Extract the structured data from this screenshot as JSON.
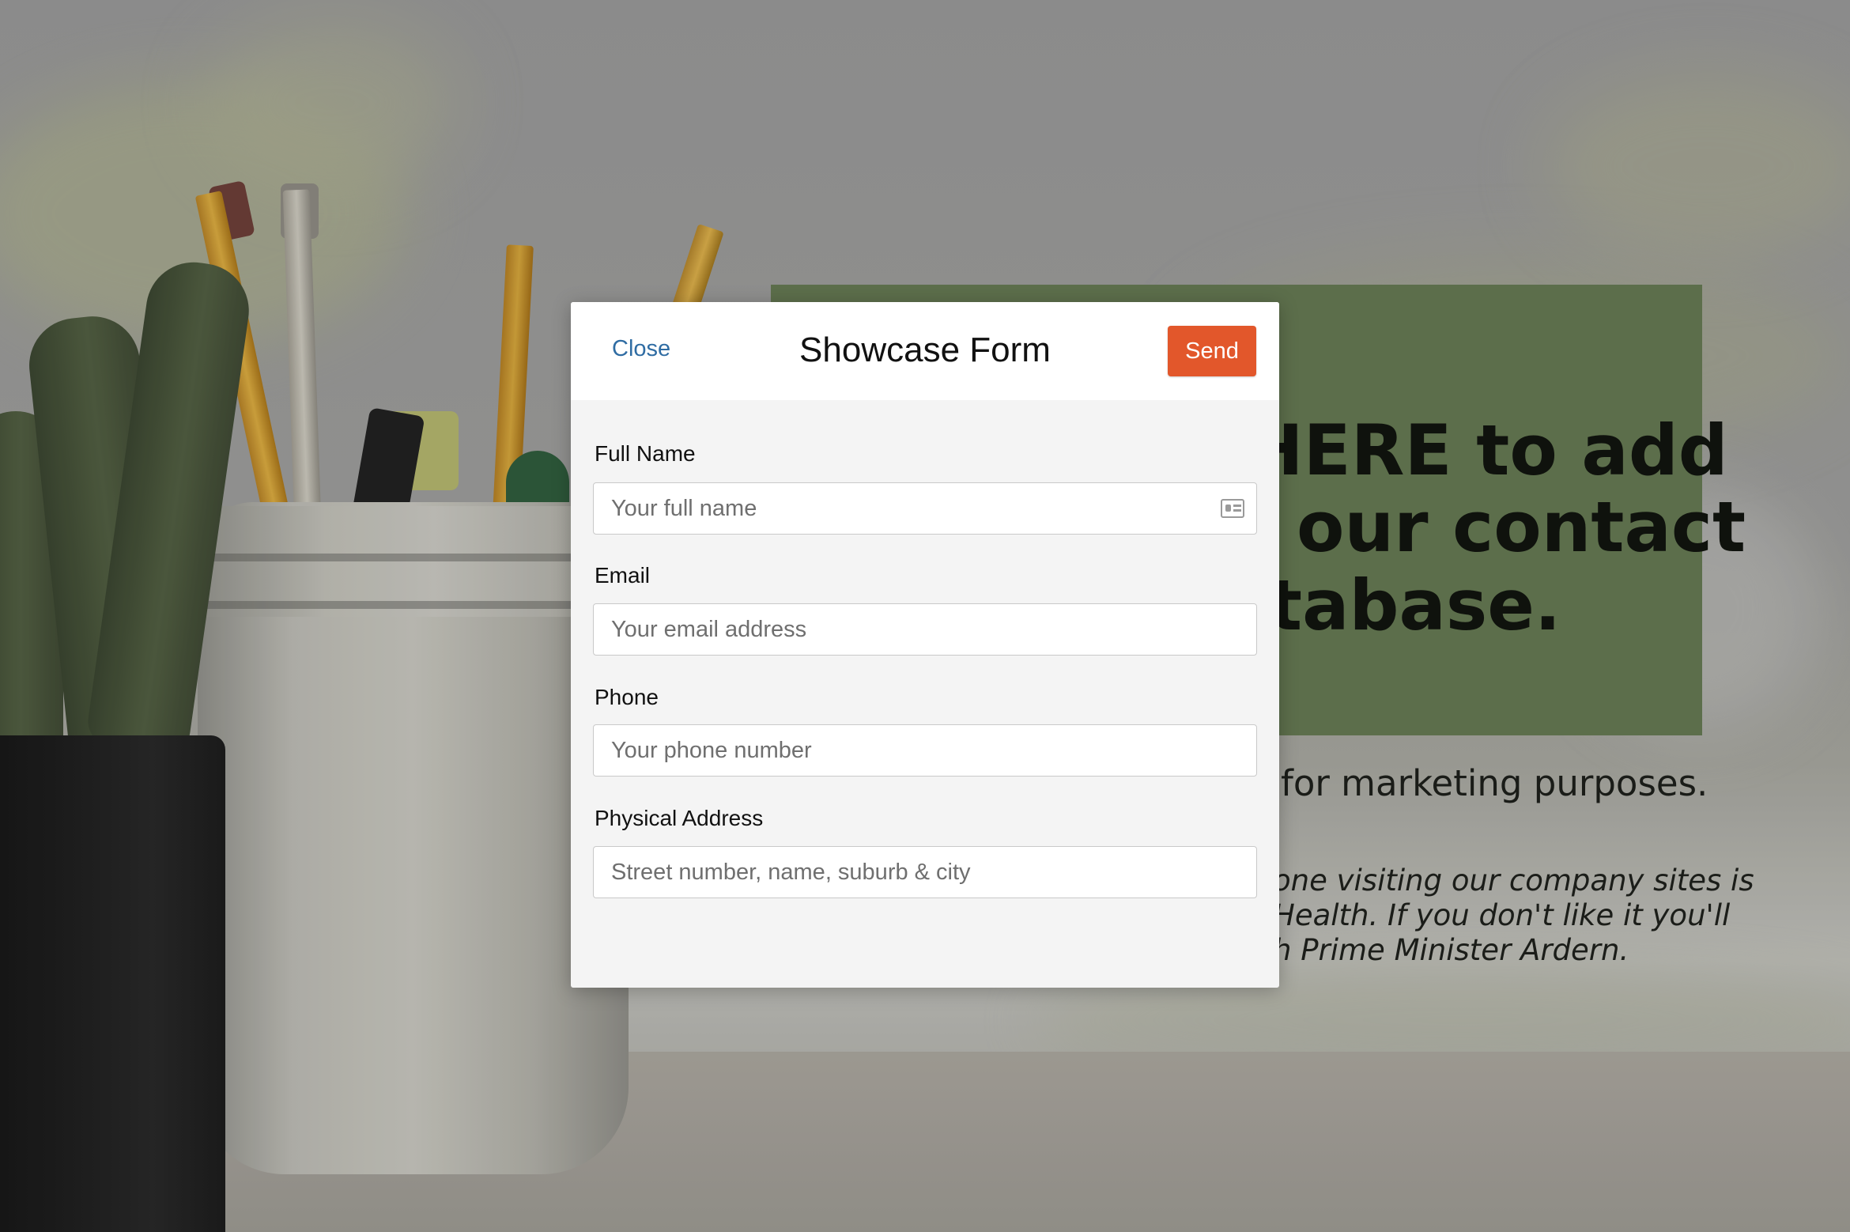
{
  "background": {
    "hero_lines": [
      "HERE to add",
      "our contact",
      "tabase."
    ],
    "hero_subline": "for marketing purposes.",
    "hero_note_lines": [
      "one visiting our company sites is",
      "Health. If you don't like it you'll",
      "h Prime Minister Ardern."
    ]
  },
  "modal": {
    "close_label": "Close",
    "title": "Showcase Form",
    "send_label": "Send"
  },
  "form": {
    "full_name": {
      "label": "Full Name",
      "placeholder": "Your full name",
      "value": ""
    },
    "email": {
      "label": "Email",
      "placeholder": "Your email address",
      "value": ""
    },
    "phone": {
      "label": "Phone",
      "placeholder": "Your phone number",
      "value": ""
    },
    "address": {
      "label": "Physical Address",
      "placeholder": "Street number, name, suburb & city",
      "value": ""
    }
  },
  "colors": {
    "send_button": "#e2572b",
    "close_link": "#2f6ca3",
    "hero_card": "#627650"
  },
  "icons": {
    "full_name_field": "contact-card-icon"
  }
}
